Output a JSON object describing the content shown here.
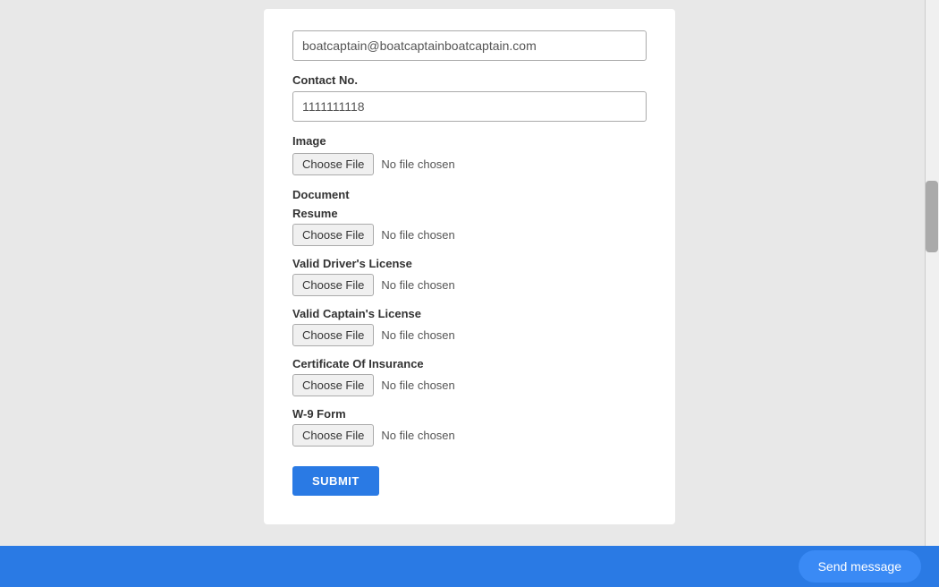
{
  "form": {
    "email_label": "",
    "email_value": "boatcaptain@boatcaptainboatcaptain.com",
    "contact_label": "Contact No.",
    "contact_value": "1111111118",
    "image_label": "Image",
    "choose_file_label": "Choose File",
    "no_file_text": "No file chosen",
    "document_label": "Document",
    "resume_label": "Resume",
    "drivers_license_label": "Valid Driver's License",
    "captains_license_label": "Valid Captain's License",
    "certificate_insurance_label": "Certificate Of Insurance",
    "w9_form_label": "W-9 Form",
    "submit_label": "SUBMIT"
  },
  "bottom_bar": {
    "send_message_label": "Send message"
  }
}
